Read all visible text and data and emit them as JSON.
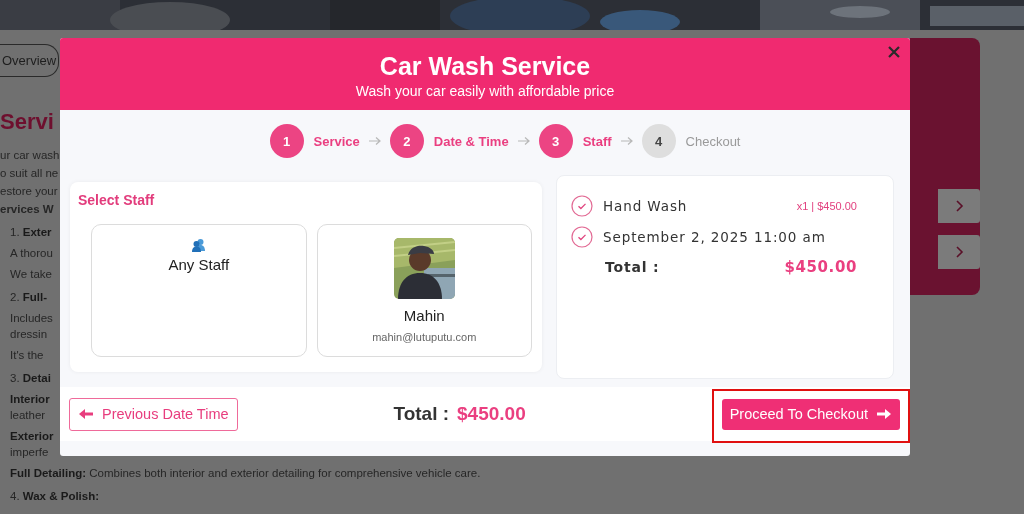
{
  "page": {
    "tab": "Overview",
    "heading": "Servi",
    "lines": [
      {
        "kind": "flush",
        "text": "ur car wash"
      },
      {
        "kind": "flush",
        "text": "o suit all ne"
      },
      {
        "kind": "flush",
        "text": "estore your"
      },
      {
        "kind": "heading",
        "text": "ervices W"
      },
      {
        "kind": "item",
        "text": "1. **Exter**"
      },
      {
        "kind": "indent",
        "text": "A thorou"
      },
      {
        "kind": "indent",
        "text": "We take"
      },
      {
        "kind": "item",
        "text": "2. **Full-**"
      },
      {
        "kind": "indent",
        "text": "Includes"
      },
      {
        "kind": "tight",
        "text": "dressin"
      },
      {
        "kind": "indent",
        "text": "It's the"
      },
      {
        "kind": "item",
        "text": "3. **Detai**"
      },
      {
        "kind": "indent",
        "text": "**Interior**"
      },
      {
        "kind": "tight",
        "text": "leather"
      },
      {
        "kind": "indent",
        "text": "**Exterior**"
      },
      {
        "kind": "tight",
        "text": "imperfe"
      },
      {
        "kind": "indent",
        "text": "**Full Detailing:** Combines both interior and exterior detailing for comprehensive vehicle care."
      },
      {
        "kind": "item",
        "text": "4. **Wax & Polish:**"
      }
    ]
  },
  "modal": {
    "title": "Car Wash Service",
    "subtitle": "Wash your car easily with affordable price",
    "steps": [
      {
        "number": "1",
        "label": "Service",
        "done": true
      },
      {
        "number": "2",
        "label": "Date & Time",
        "done": true
      },
      {
        "number": "3",
        "label": "Staff",
        "done": true
      },
      {
        "number": "4",
        "label": "Checkout",
        "done": false
      }
    ],
    "staff_panel": {
      "title": "Select Staff",
      "options": [
        {
          "kind": "any",
          "name": "Any Staff"
        },
        {
          "kind": "person",
          "name": "Mahin",
          "email": "mahin@lutuputu.com"
        }
      ]
    },
    "summary": {
      "items": [
        {
          "text": "Hand Wash",
          "detail": "x1 | $450.00"
        },
        {
          "text": "September 2, 2025 11:00 am"
        }
      ],
      "total_label": "Total :",
      "total": "$450.00"
    },
    "footer": {
      "back": "Previous Date Time",
      "total_label": "Total :",
      "total": "$450.00",
      "next": "Proceed To Checkout",
      "highlighted": true
    }
  }
}
